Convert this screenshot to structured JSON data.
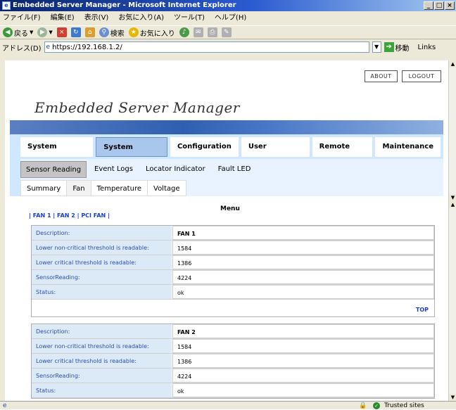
{
  "window": {
    "title": "Embedded Server Manager - Microsoft Internet Explorer"
  },
  "menubar": [
    "ファイル(F)",
    "編集(E)",
    "表示(V)",
    "お気に入り(A)",
    "ツール(T)",
    "ヘルプ(H)"
  ],
  "toolbar": {
    "back": "戻る",
    "search": "検索",
    "favorites": "お気に入り"
  },
  "address": {
    "label": "アドレス(D)",
    "url": "https://192.168.1.2/",
    "go": "移動",
    "links": "Links"
  },
  "header": {
    "about": "ABOUT",
    "logout": "LOGOUT",
    "logo": "Embedded Server Manager"
  },
  "nav": {
    "level1": [
      "System Information",
      "System Monitoring",
      "Configuration",
      "User Management",
      "Remote Control",
      "Maintenance"
    ],
    "level1_active": "System Monitoring",
    "level2": [
      "Sensor Reading",
      "Event Logs",
      "Locator Indicator",
      "Fault LED"
    ],
    "level2_active": "Sensor Reading",
    "level3": [
      "Summary",
      "Fan",
      "Temperature",
      "Voltage"
    ],
    "level3_active": "Fan"
  },
  "content": {
    "menu_title": "Menu",
    "fan_links": [
      "FAN 1",
      "FAN 2",
      "PCI FAN"
    ],
    "top_label": "TOP",
    "fans": [
      {
        "rows": [
          {
            "key": "Description:",
            "value": "FAN 1"
          },
          {
            "key": "Lower non-critical threshold is readable:",
            "value": "1584"
          },
          {
            "key": "Lower critical threshold is readable:",
            "value": "1386"
          },
          {
            "key": "SensorReading:",
            "value": "4224"
          },
          {
            "key": "Status:",
            "value": "ok"
          }
        ]
      },
      {
        "rows": [
          {
            "key": "Description:",
            "value": "FAN 2"
          },
          {
            "key": "Lower non-critical threshold is readable:",
            "value": "1584"
          },
          {
            "key": "Lower critical threshold is readable:",
            "value": "1386"
          },
          {
            "key": "SensorReading:",
            "value": "4224"
          },
          {
            "key": "Status:",
            "value": "ok"
          }
        ]
      }
    ]
  },
  "status": {
    "zone": "Trusted sites"
  }
}
